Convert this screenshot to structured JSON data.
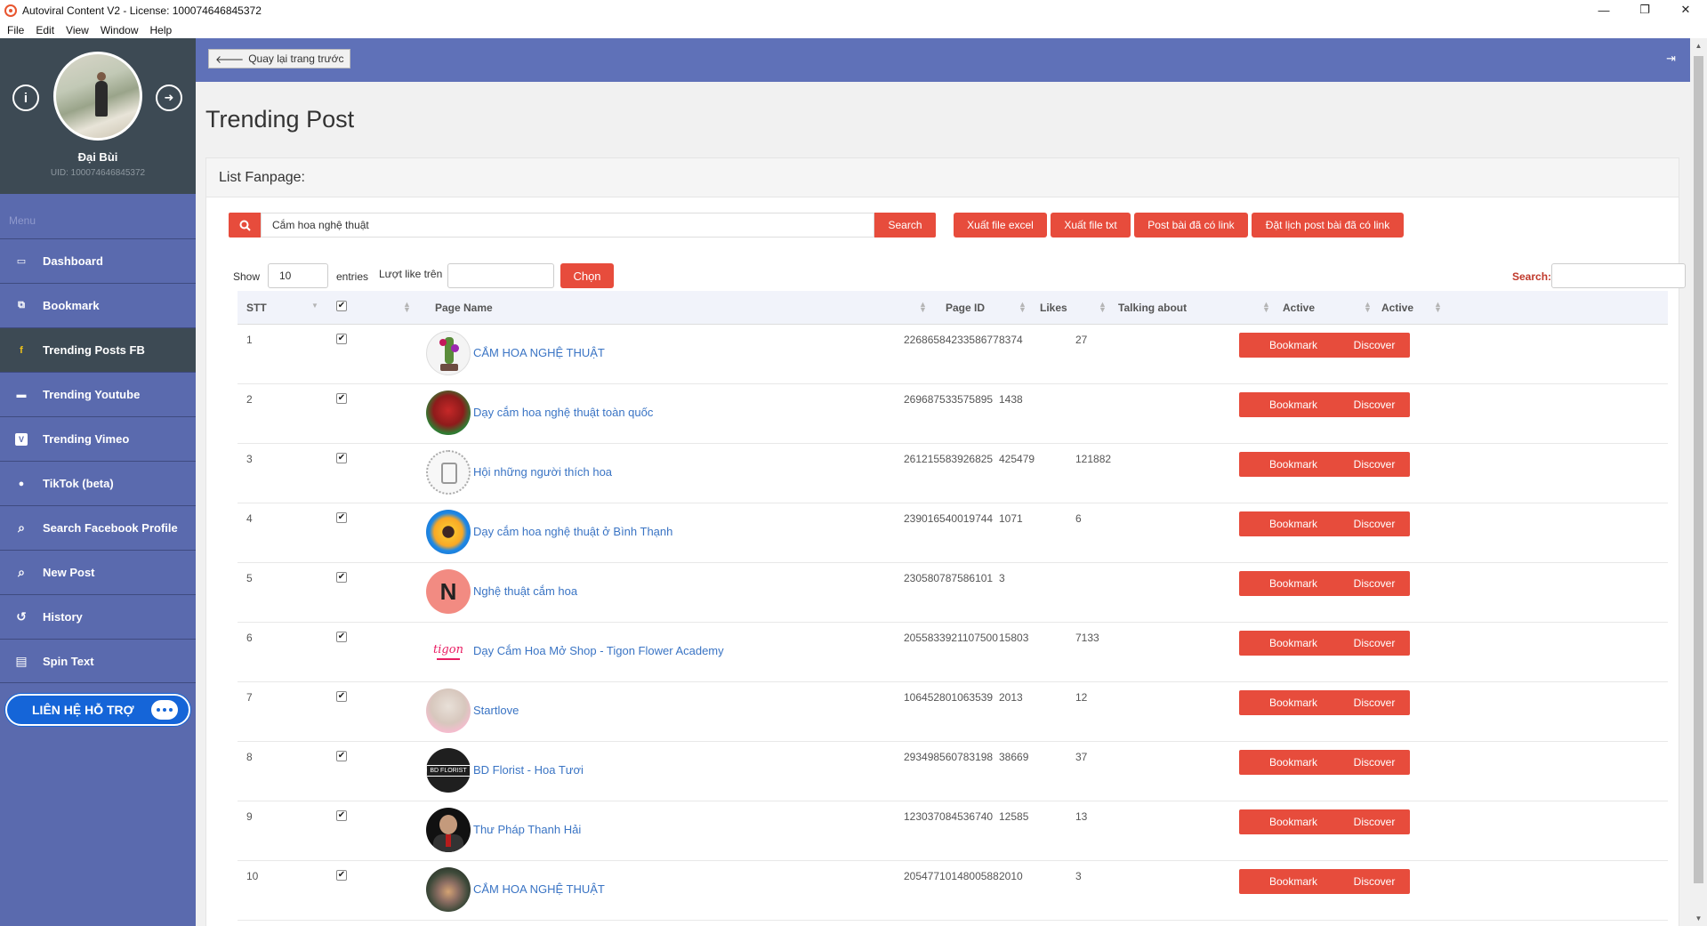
{
  "window": {
    "title": "Autoviral Content V2 - License: 100074646845372",
    "controls": {
      "minimize": "—",
      "restore": "❐",
      "close": "✕"
    }
  },
  "menubar": [
    "File",
    "Edit",
    "View",
    "Window",
    "Help"
  ],
  "profile": {
    "name": "Đại Bùi",
    "uid": "UID: 100074646845372"
  },
  "sidebar": {
    "menu_label": "Menu",
    "items": [
      {
        "label": "Dashboard",
        "icon": "monitor-icon",
        "glyph": "▭"
      },
      {
        "label": "Bookmark",
        "icon": "bookmark-icon",
        "glyph": "⧉"
      },
      {
        "label": "Trending Posts FB",
        "icon": "facebook-icon",
        "glyph": "f"
      },
      {
        "label": "Trending Youtube",
        "icon": "youtube-icon",
        "glyph": "▬"
      },
      {
        "label": "Trending Vimeo",
        "icon": "vimeo-icon",
        "glyph": "V"
      },
      {
        "label": "TikTok (beta)",
        "icon": "globe-icon",
        "glyph": "●"
      },
      {
        "label": "Search Facebook Profile",
        "icon": "search-icon",
        "glyph": "⌕"
      },
      {
        "label": "New Post",
        "icon": "search-icon",
        "glyph": "⌕"
      },
      {
        "label": "History",
        "icon": "history-icon",
        "glyph": "↺"
      },
      {
        "label": "Spin Text",
        "icon": "file-icon",
        "glyph": "▤"
      }
    ],
    "active_index": 2,
    "support_label": "LIÊN HỆ HỖ TRỢ"
  },
  "topbar": {
    "back_label": "Quay lại trang trước"
  },
  "page": {
    "title": "Trending Post",
    "panel_title": "List Fanpage:"
  },
  "search": {
    "value": "Cắm hoa nghệ thuật",
    "button": "Search"
  },
  "actions": [
    "Xuất file excel",
    "Xuất file txt",
    "Post bài đã có link",
    "Đặt lịch post bài đã có link"
  ],
  "filters": {
    "show_label": "Show",
    "show_value": "10",
    "entries_label": "entries",
    "like_label": "Lượt like trên",
    "like_value": "",
    "choose_button": "Chọn",
    "search_label": "Search:",
    "search_value": ""
  },
  "table": {
    "columns": [
      "STT",
      "",
      "Page Name",
      "Page ID",
      "Likes",
      "Talking about",
      "Active",
      "Active"
    ],
    "bookmark_label": "Bookmark",
    "discover_label": "Discover",
    "check_glyph": "✔",
    "rows": [
      {
        "stt": "1",
        "name": "CẮM HOA NGHỆ THUẬT",
        "page_id": "2268658423358677",
        "likes": "8374",
        "talking": "27",
        "avatar": "flower-arrangement"
      },
      {
        "stt": "2",
        "name": "Dạy cắm hoa nghệ thuật toàn quốc",
        "page_id": "269687533575895",
        "likes": "1438",
        "talking": "",
        "avatar": "red-roses"
      },
      {
        "stt": "3",
        "name": "Hội những người thích hoa",
        "page_id": "261215583926825",
        "likes": "425479",
        "talking": "121882",
        "avatar": "floral-frame"
      },
      {
        "stt": "4",
        "name": "Dạy cắm hoa nghệ thuật ở Bình Thạnh",
        "page_id": "239016540019744",
        "likes": "1071",
        "talking": "6",
        "avatar": "sunflower"
      },
      {
        "stt": "5",
        "name": "Nghệ thuật cắm hoa",
        "page_id": "230580787586101",
        "likes": "3",
        "talking": "",
        "avatar": "letter-n",
        "avatar_letter": "N"
      },
      {
        "stt": "6",
        "name": "Dạy Cắm Hoa Mở Shop - Tigon Flower Academy",
        "page_id": "2055833921107500",
        "likes": "15803",
        "talking": "7133",
        "avatar": "tigon-logo",
        "avatar_text": "tigon"
      },
      {
        "stt": "7",
        "name": "Startlove",
        "page_id": "106452801063539",
        "likes": "2013",
        "talking": "12",
        "avatar": "startlove-logo"
      },
      {
        "stt": "8",
        "name": "BD Florist - Hoa Tươi",
        "page_id": "293498560783198",
        "likes": "38669",
        "talking": "37",
        "avatar": "bd-florist-logo",
        "avatar_text": "BD FLORIST"
      },
      {
        "stt": "9",
        "name": "Thư Pháp Thanh Hải",
        "page_id": "123037084536740",
        "likes": "12585",
        "talking": "13",
        "avatar": "man-portrait"
      },
      {
        "stt": "10",
        "name": "CẮM HOA NGHỆ THUẬT",
        "page_id": "2054771014800588",
        "likes": "2010",
        "talking": "3",
        "avatar": "bouquet-dark"
      }
    ]
  },
  "colors": {
    "accent_red": "#e74c3c",
    "sidebar_blue": "#5a6aae",
    "header_blue": "#5f71b8",
    "link_blue": "#3a74c4",
    "profile_dark": "#3d4a54"
  }
}
